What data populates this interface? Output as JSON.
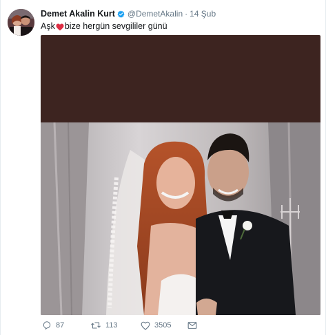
{
  "tweet": {
    "author_name": "Demet Akalin Kurt",
    "handle": "@DemetAkalin",
    "separator": "·",
    "date": "14 Şub",
    "text_before": "Aşk",
    "text_after": "bize hergün sevgililer günü",
    "verified_icon": "verified-badge-icon",
    "heart_icon": "red-heart-emoji-icon"
  },
  "actions": {
    "reply_count": "87",
    "retweet_count": "113",
    "like_count": "3505",
    "reply_icon": "reply-icon",
    "retweet_icon": "retweet-icon",
    "like_icon": "heart-outline-icon",
    "message_icon": "direct-message-icon"
  },
  "colors": {
    "verified": "#1da1f2",
    "heart": "#e0245e",
    "secondary_text": "#657786",
    "media_top_band": "#3d2420"
  }
}
